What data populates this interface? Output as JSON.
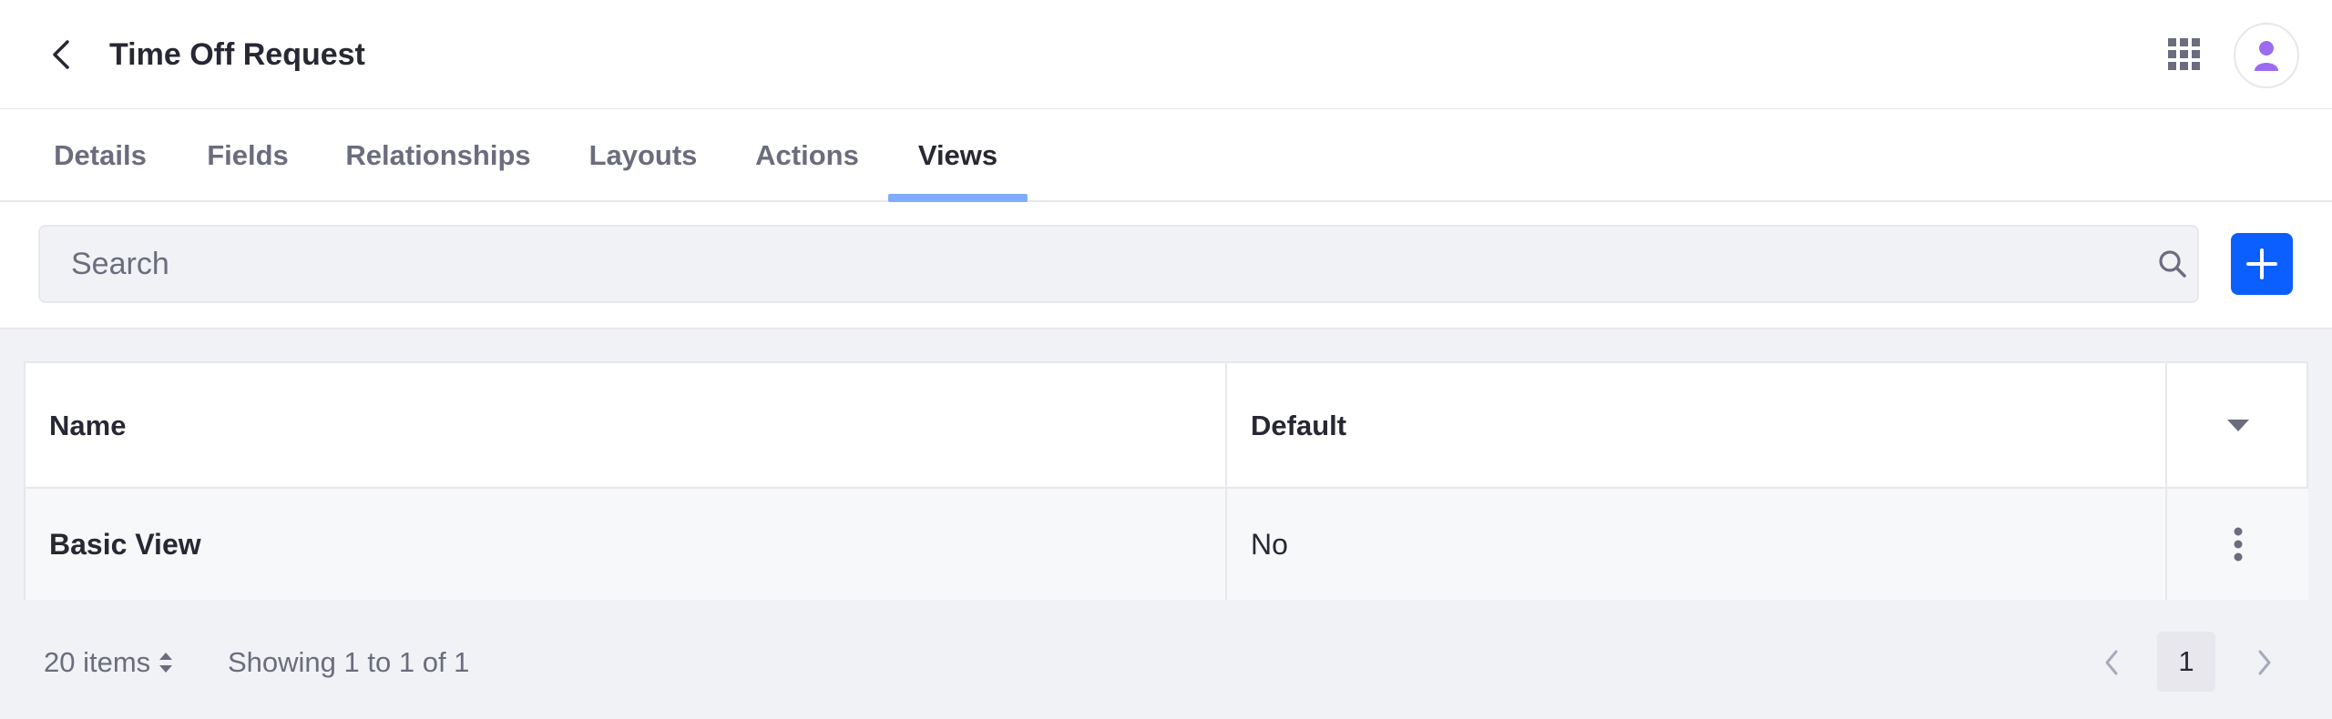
{
  "header": {
    "title": "Time Off Request",
    "back_icon": "chevron-left-icon",
    "apps_icon": "apps-grid-icon",
    "avatar_icon": "user-icon"
  },
  "tabs": [
    {
      "label": "Details",
      "active": false
    },
    {
      "label": "Fields",
      "active": false
    },
    {
      "label": "Relationships",
      "active": false
    },
    {
      "label": "Layouts",
      "active": false
    },
    {
      "label": "Actions",
      "active": false
    },
    {
      "label": "Views",
      "active": true
    }
  ],
  "toolbar": {
    "search_placeholder": "Search",
    "search_value": "",
    "add_icon": "plus-icon"
  },
  "table": {
    "columns": [
      "Name",
      "Default"
    ],
    "rows": [
      {
        "name": "Basic View",
        "default": "No"
      }
    ]
  },
  "pagination": {
    "per_page": "20 items",
    "showing": "Showing 1 to 1 of 1",
    "current_page": "1"
  },
  "colors": {
    "primary": "#0b5fff",
    "tab_underline": "#80acff",
    "avatar": "#9c6cf0",
    "text": "#272833",
    "muted": "#6b6c7e"
  }
}
